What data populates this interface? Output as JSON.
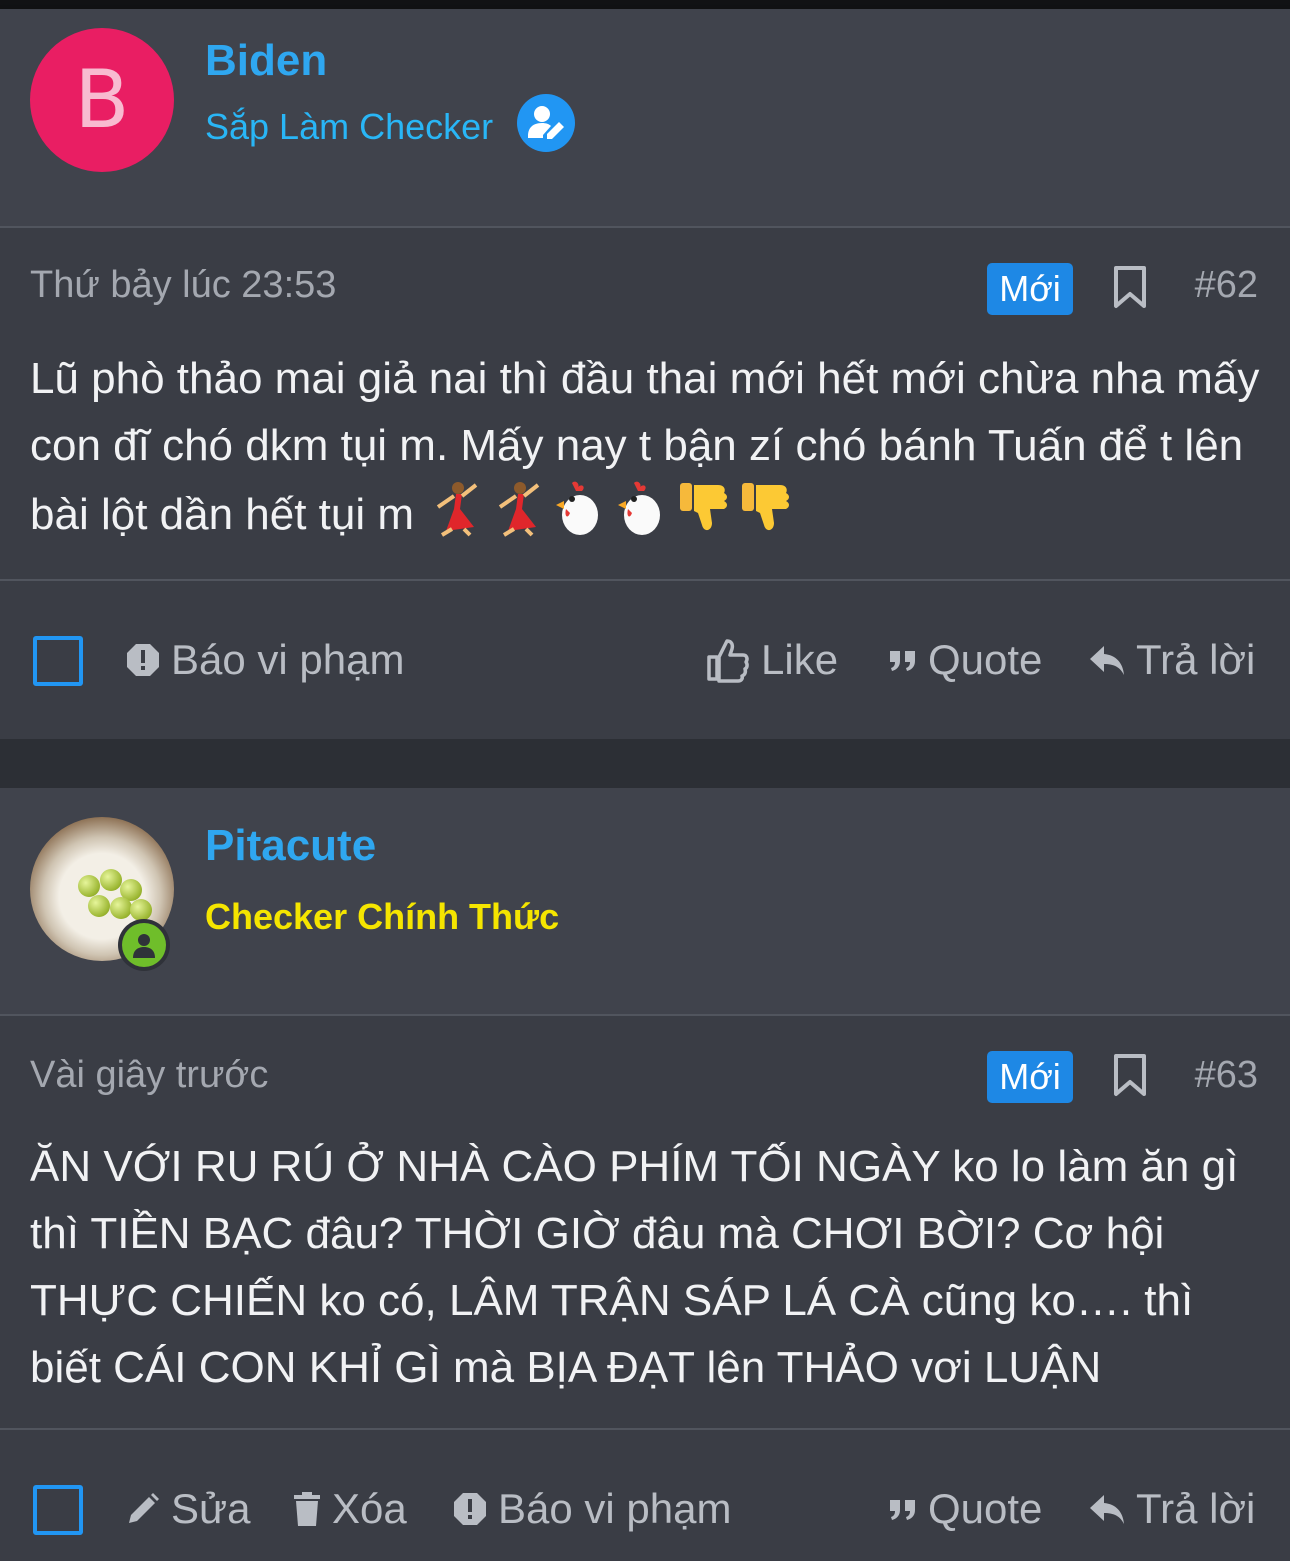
{
  "posts": [
    {
      "username": "Biden",
      "avatar_letter": "B",
      "user_title": "Sắp Làm Checker",
      "timestamp": "Thứ bảy lúc 23:53",
      "badge": "Mới",
      "post_number": "#62",
      "body": "Lũ phò thảo mai giả nai thì đầu thai mới hết mới chừa nha mấy con đĩ chó dkm tụi m. Mấy nay t bận zí chó bánh Tuấn để t lên bài lột dần hết tụi m",
      "emojis": [
        "dancer-icon",
        "dancer-icon",
        "rooster-icon",
        "rooster-icon",
        "thumbs-down-icon",
        "thumbs-down-icon"
      ],
      "actions": {
        "report": "Báo vi phạm",
        "like": "Like",
        "quote": "Quote",
        "reply": "Trả lời"
      }
    },
    {
      "username": "Pitacute",
      "user_title": "Checker Chính Thức",
      "timestamp": "Vài giây trước",
      "badge": "Mới",
      "post_number": "#63",
      "body": "ĂN VỚI RU RÚ Ở NHÀ CÀO PHÍM TỐI NGÀY ko lo làm ăn gì thì TIỀN BẠC đâu? THỜI GIỜ đâu mà CHƠI BỜI? Cơ hội THỰC CHIẾN ko có, LÂM TRẬN SÁP LÁ CÀ cũng ko…. thì biết CÁI CON KHỈ GÌ mà BỊA ĐẠT lên THẢO vơi LUẬN",
      "actions": {
        "edit": "Sửa",
        "delete": "Xóa",
        "report": "Báo vi phạm",
        "quote": "Quote",
        "reply": "Trả lời"
      }
    }
  ],
  "colors": {
    "username": "#2fa7f0",
    "title_member": "#29b6f6",
    "title_checker": "#f5e500",
    "badge": "#1e88e5",
    "avatar_bg": "#e91e63",
    "online": "#6fbe2a"
  }
}
